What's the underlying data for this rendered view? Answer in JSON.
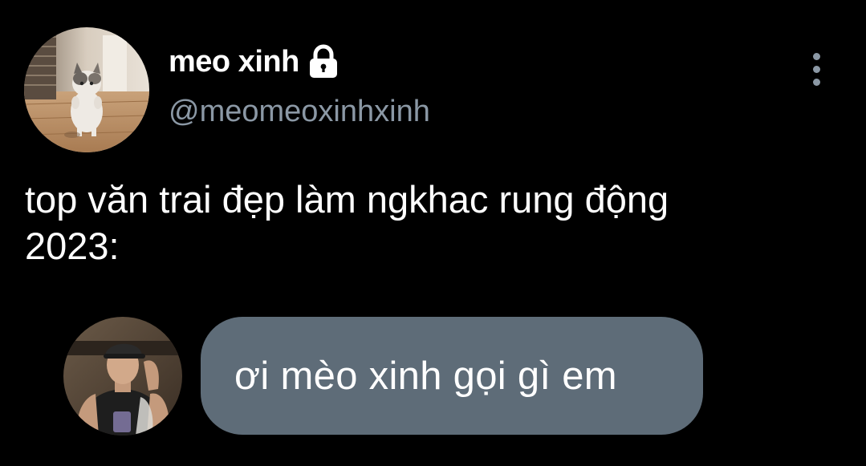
{
  "author": {
    "display_name": "meo xinh",
    "handle": "@meomeoxinhxinh",
    "avatar_icon": "cat-photo-avatar",
    "protected_icon": "lock-icon"
  },
  "menu": {
    "icon": "more-vertical-icon"
  },
  "tweet": {
    "text": "top văn trai đẹp làm ngkhac rung động\n2023:"
  },
  "embedded_chat": {
    "avatar_icon": "man-photo-avatar",
    "message": "ơi mèo xinh gọi gì em",
    "bubble_color": "#5e6c78"
  },
  "colors": {
    "background": "#000000",
    "primary_text": "#ffffff",
    "secondary_text": "#8b98a5"
  }
}
